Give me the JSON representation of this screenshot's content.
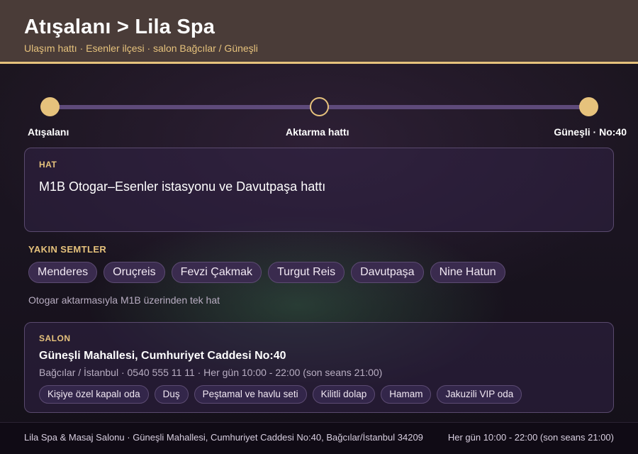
{
  "header": {
    "title": "Atışalanı > Lila Spa",
    "subtitle": "Ulaşım hattı · Esenler ilçesi · salon Bağcılar / Güneşli"
  },
  "timeline": {
    "stops": [
      {
        "label": "Atışalanı",
        "state": "filled"
      },
      {
        "label": "Aktarma hattı",
        "state": "hollow"
      },
      {
        "label": "Güneşli · No:40",
        "state": "filled"
      }
    ]
  },
  "line_card": {
    "label": "HAT",
    "text": "M1B Otogar–Esenler istasyonu ve Davutpaşa hattı"
  },
  "nearby": {
    "label": "YAKIN SEMTLER",
    "items": [
      "Menderes",
      "Oruçreis",
      "Fevzi Çakmak",
      "Turgut Reis",
      "Davutpaşa",
      "Nine Hatun"
    ],
    "note": "Otogar aktarmasıyla M1B üzerinden tek hat"
  },
  "salon": {
    "label": "SALON",
    "address": "Güneşli Mahallesi, Cumhuriyet Caddesi No:40",
    "meta": "Bağcılar / İstanbul · 0540 555 11 11 · Her gün 10:00 - 22:00 (son seans 21:00)",
    "amenities": [
      "Kişiye özel kapalı oda",
      "Duş",
      "Peştamal ve havlu seti",
      "Kilitli dolap",
      "Hamam",
      "Jakuzili VIP oda"
    ]
  },
  "footer": {
    "left": "Lila Spa & Masaj Salonu · Güneşli Mahallesi, Cumhuriyet Caddesi No:40, Bağcılar/İstanbul 34209",
    "right": "Her gün 10:00 - 22:00 (son seans 21:00)"
  },
  "colors": {
    "accent": "#e6c27c",
    "header_bg": "#4a3c38",
    "track": "#5e4a7a"
  }
}
